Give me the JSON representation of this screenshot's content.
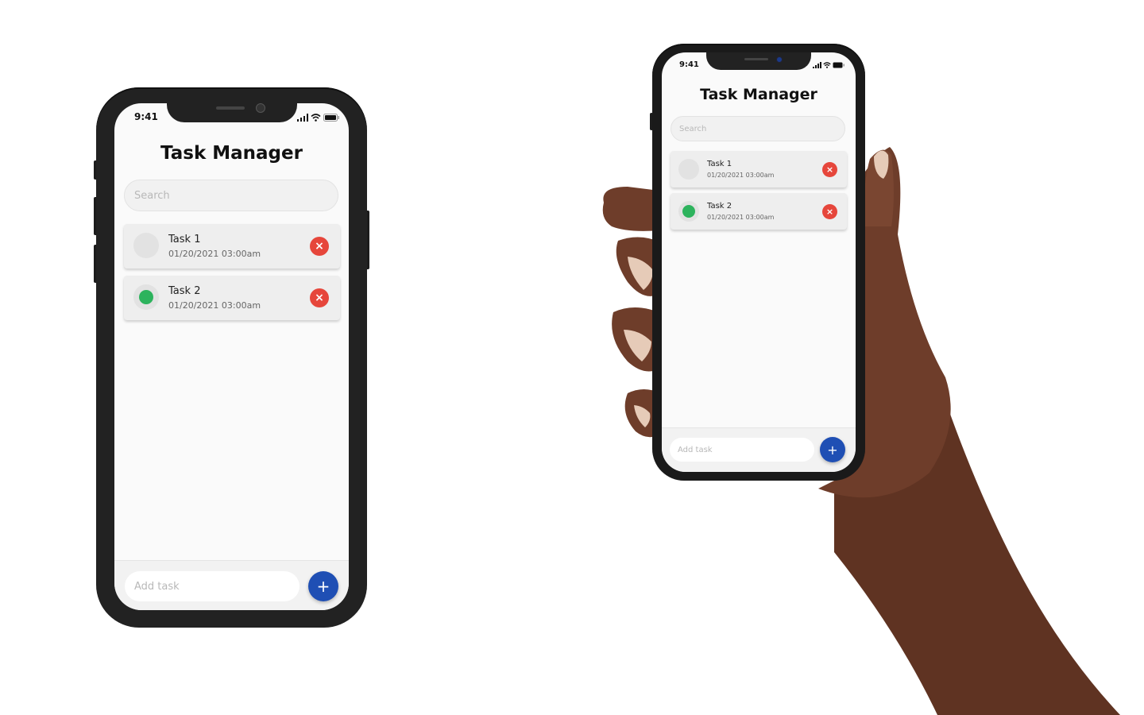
{
  "status": {
    "time": "9:41"
  },
  "app": {
    "title": "Task Manager"
  },
  "search": {
    "placeholder": "Search"
  },
  "tasks": [
    {
      "name": "Task 1",
      "date": "01/20/2021 03:00am",
      "completed": false
    },
    {
      "name": "Task 2",
      "date": "01/20/2021 03:00am",
      "completed": true
    }
  ],
  "task_actions": {
    "delete_symbol": "×"
  },
  "composer": {
    "placeholder": "Add task",
    "add_symbol": "+"
  },
  "colors": {
    "accent": "#1f4fb4",
    "delete": "#e6463b",
    "done": "#2db35d",
    "frame": "#222222",
    "skin": "#6e3d2a"
  },
  "icons": [
    "signal-icon",
    "wifi-icon",
    "battery-icon",
    "close-icon",
    "plus-icon"
  ]
}
